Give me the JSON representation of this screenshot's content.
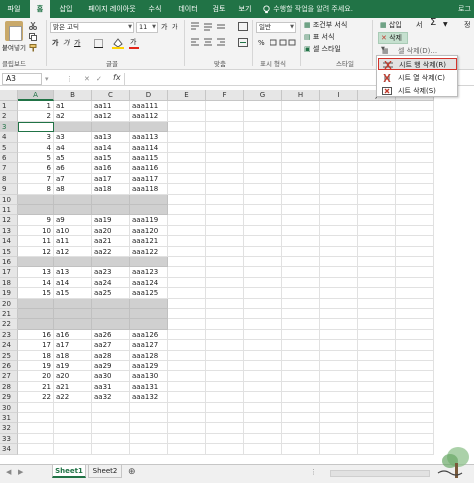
{
  "ribbon_tabs": [
    "파일",
    "홈",
    "삽입",
    "페이지 레이아웃",
    "수식",
    "데이터",
    "검토",
    "보기"
  ],
  "tell_me": "수행할 작업을 알려 주세요.",
  "tab_right_cut": "로그",
  "clipboard": {
    "paste": "붙여넣기",
    "label": "클립보드"
  },
  "font": {
    "name": "맑은 고딕",
    "size": "11",
    "bold": "가",
    "italic": "가",
    "underline": "가",
    "grow": "가",
    "shrink": "가",
    "label": "글꼴"
  },
  "alignment": {
    "label": "맞춤"
  },
  "number": {
    "format": "일반",
    "label": "표시 형식",
    "percent": "%"
  },
  "styles": {
    "conditional": "조건부 서식",
    "table": "표 서식",
    "cell": "셀 스타일",
    "label": "스타일"
  },
  "cells": {
    "insert": "삽입",
    "delete": "삭제",
    "format_cut": "서",
    "editing_cut": "정"
  },
  "delete_menu": [
    {
      "label": "셀 삭제(D)..."
    },
    {
      "label": "시트 행 삭제(R)"
    },
    {
      "label": "시트 열 삭제(C)"
    },
    {
      "label": "시트 삭제(S)"
    }
  ],
  "formula_bar": {
    "name_box": "A3",
    "fx": "fx",
    "value": ""
  },
  "columns": [
    "A",
    "B",
    "C",
    "D",
    "E",
    "F",
    "G",
    "H",
    "I",
    "J",
    "K"
  ],
  "rows": [
    {
      "n": "1",
      "a": "1",
      "b": "a1",
      "c": "aa11",
      "d": "aaa111",
      "gray": false
    },
    {
      "n": "2",
      "a": "2",
      "b": "a2",
      "c": "aa12",
      "d": "aaa112",
      "gray": false
    },
    {
      "n": "3",
      "a": "",
      "b": "",
      "c": "",
      "d": "",
      "gray": true
    },
    {
      "n": "4",
      "a": "3",
      "b": "a3",
      "c": "aa13",
      "d": "aaa113",
      "gray": false
    },
    {
      "n": "5",
      "a": "4",
      "b": "a4",
      "c": "aa14",
      "d": "aaa114",
      "gray": false
    },
    {
      "n": "6",
      "a": "5",
      "b": "a5",
      "c": "aa15",
      "d": "aaa115",
      "gray": false
    },
    {
      "n": "7",
      "a": "6",
      "b": "a6",
      "c": "aa16",
      "d": "aaa116",
      "gray": false
    },
    {
      "n": "8",
      "a": "7",
      "b": "a7",
      "c": "aa17",
      "d": "aaa117",
      "gray": false
    },
    {
      "n": "9",
      "a": "8",
      "b": "a8",
      "c": "aa18",
      "d": "aaa118",
      "gray": false
    },
    {
      "n": "10",
      "a": "",
      "b": "",
      "c": "",
      "d": "",
      "gray": true
    },
    {
      "n": "11",
      "a": "",
      "b": "",
      "c": "",
      "d": "",
      "gray": true
    },
    {
      "n": "12",
      "a": "9",
      "b": "a9",
      "c": "aa19",
      "d": "aaa119",
      "gray": false
    },
    {
      "n": "13",
      "a": "10",
      "b": "a10",
      "c": "aa20",
      "d": "aaa120",
      "gray": false
    },
    {
      "n": "14",
      "a": "11",
      "b": "a11",
      "c": "aa21",
      "d": "aaa121",
      "gray": false
    },
    {
      "n": "15",
      "a": "12",
      "b": "a12",
      "c": "aa22",
      "d": "aaa122",
      "gray": false
    },
    {
      "n": "16",
      "a": "",
      "b": "",
      "c": "",
      "d": "",
      "gray": true
    },
    {
      "n": "17",
      "a": "13",
      "b": "a13",
      "c": "aa23",
      "d": "aaa123",
      "gray": false
    },
    {
      "n": "18",
      "a": "14",
      "b": "a14",
      "c": "aa24",
      "d": "aaa124",
      "gray": false
    },
    {
      "n": "19",
      "a": "15",
      "b": "a15",
      "c": "aa25",
      "d": "aaa125",
      "gray": false
    },
    {
      "n": "20",
      "a": "",
      "b": "",
      "c": "",
      "d": "",
      "gray": true
    },
    {
      "n": "21",
      "a": "",
      "b": "",
      "c": "",
      "d": "",
      "gray": true
    },
    {
      "n": "22",
      "a": "",
      "b": "",
      "c": "",
      "d": "",
      "gray": true
    },
    {
      "n": "23",
      "a": "16",
      "b": "a16",
      "c": "aa26",
      "d": "aaa126",
      "gray": false
    },
    {
      "n": "24",
      "a": "17",
      "b": "a17",
      "c": "aa27",
      "d": "aaa127",
      "gray": false
    },
    {
      "n": "25",
      "a": "18",
      "b": "a18",
      "c": "aa28",
      "d": "aaa128",
      "gray": false
    },
    {
      "n": "26",
      "a": "19",
      "b": "a19",
      "c": "aa29",
      "d": "aaa129",
      "gray": false
    },
    {
      "n": "27",
      "a": "20",
      "b": "a20",
      "c": "aa30",
      "d": "aaa130",
      "gray": false
    },
    {
      "n": "28",
      "a": "21",
      "b": "a21",
      "c": "aa31",
      "d": "aaa131",
      "gray": false
    },
    {
      "n": "29",
      "a": "22",
      "b": "a22",
      "c": "aa32",
      "d": "aaa132",
      "gray": false
    },
    {
      "n": "30",
      "a": "",
      "b": "",
      "c": "",
      "d": "",
      "gray": false
    },
    {
      "n": "31",
      "a": "",
      "b": "",
      "c": "",
      "d": "",
      "gray": false
    },
    {
      "n": "32",
      "a": "",
      "b": "",
      "c": "",
      "d": "",
      "gray": false
    },
    {
      "n": "33",
      "a": "",
      "b": "",
      "c": "",
      "d": "",
      "gray": false
    },
    {
      "n": "34",
      "a": "",
      "b": "",
      "c": "",
      "d": "",
      "gray": false
    }
  ],
  "active_cell": {
    "row": "3",
    "col": "A"
  },
  "sheets": [
    "Sheet1",
    "Sheet2"
  ],
  "active_sheet": "Sheet1",
  "colors": {
    "accent": "#217346",
    "highlight_border": "#d4332b",
    "gray_row": "#d0d0d0"
  },
  "watermark_icon": "tree-logo-icon"
}
